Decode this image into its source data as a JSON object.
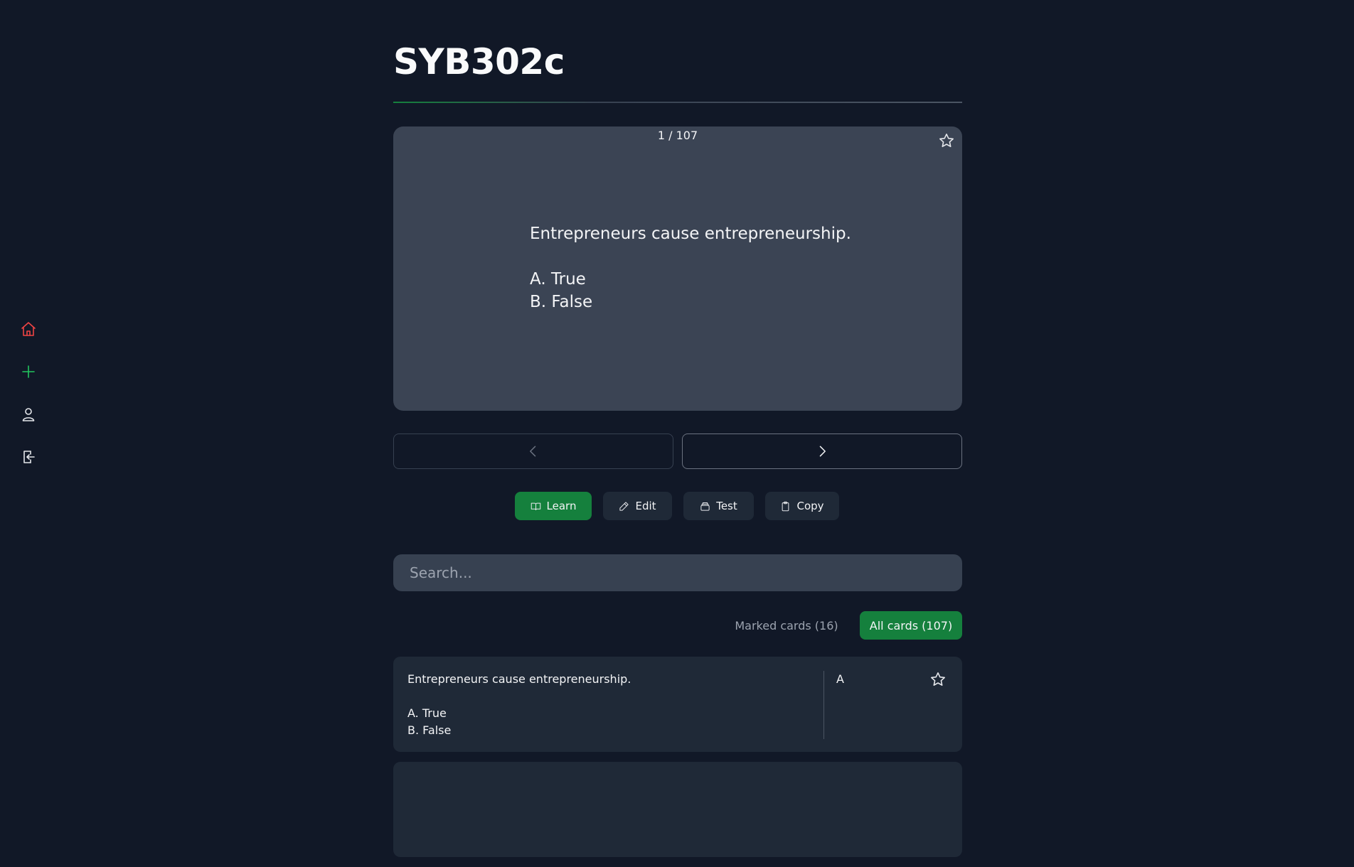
{
  "sidebar": {
    "items": [
      {
        "icon": "home-icon",
        "color": "#ef4444"
      },
      {
        "icon": "plus-icon",
        "color": "#22c55e"
      },
      {
        "icon": "user-icon",
        "color": "#e5e7eb"
      },
      {
        "icon": "logout-icon",
        "color": "#e5e7eb"
      }
    ]
  },
  "page": {
    "title": "SYB302c"
  },
  "flashcard": {
    "counter": "1 / 107",
    "lines": [
      "Entrepreneurs cause entrepreneurship.",
      "",
      "A. True",
      "B. False"
    ],
    "starred": false
  },
  "navigation": {
    "prev_icon": "chevron-left-icon",
    "next_icon": "chevron-right-icon",
    "prev_enabled": false
  },
  "actions": {
    "learn_label": "Learn",
    "edit_label": "Edit",
    "test_label": "Test",
    "copy_label": "Copy"
  },
  "search": {
    "placeholder": "Search...",
    "value": ""
  },
  "filters": {
    "marked_label": "Marked cards (16)",
    "all_label": "All cards (107)",
    "active": "all"
  },
  "cards": [
    {
      "term_lines": [
        "Entrepreneurs cause entrepreneurship.",
        "",
        "A. True",
        "B. False"
      ],
      "definition": "A",
      "starred": false
    }
  ],
  "colors": {
    "background": "#111827",
    "accent": "#15803d",
    "card": "#3b4454",
    "panel": "#1f2937"
  }
}
